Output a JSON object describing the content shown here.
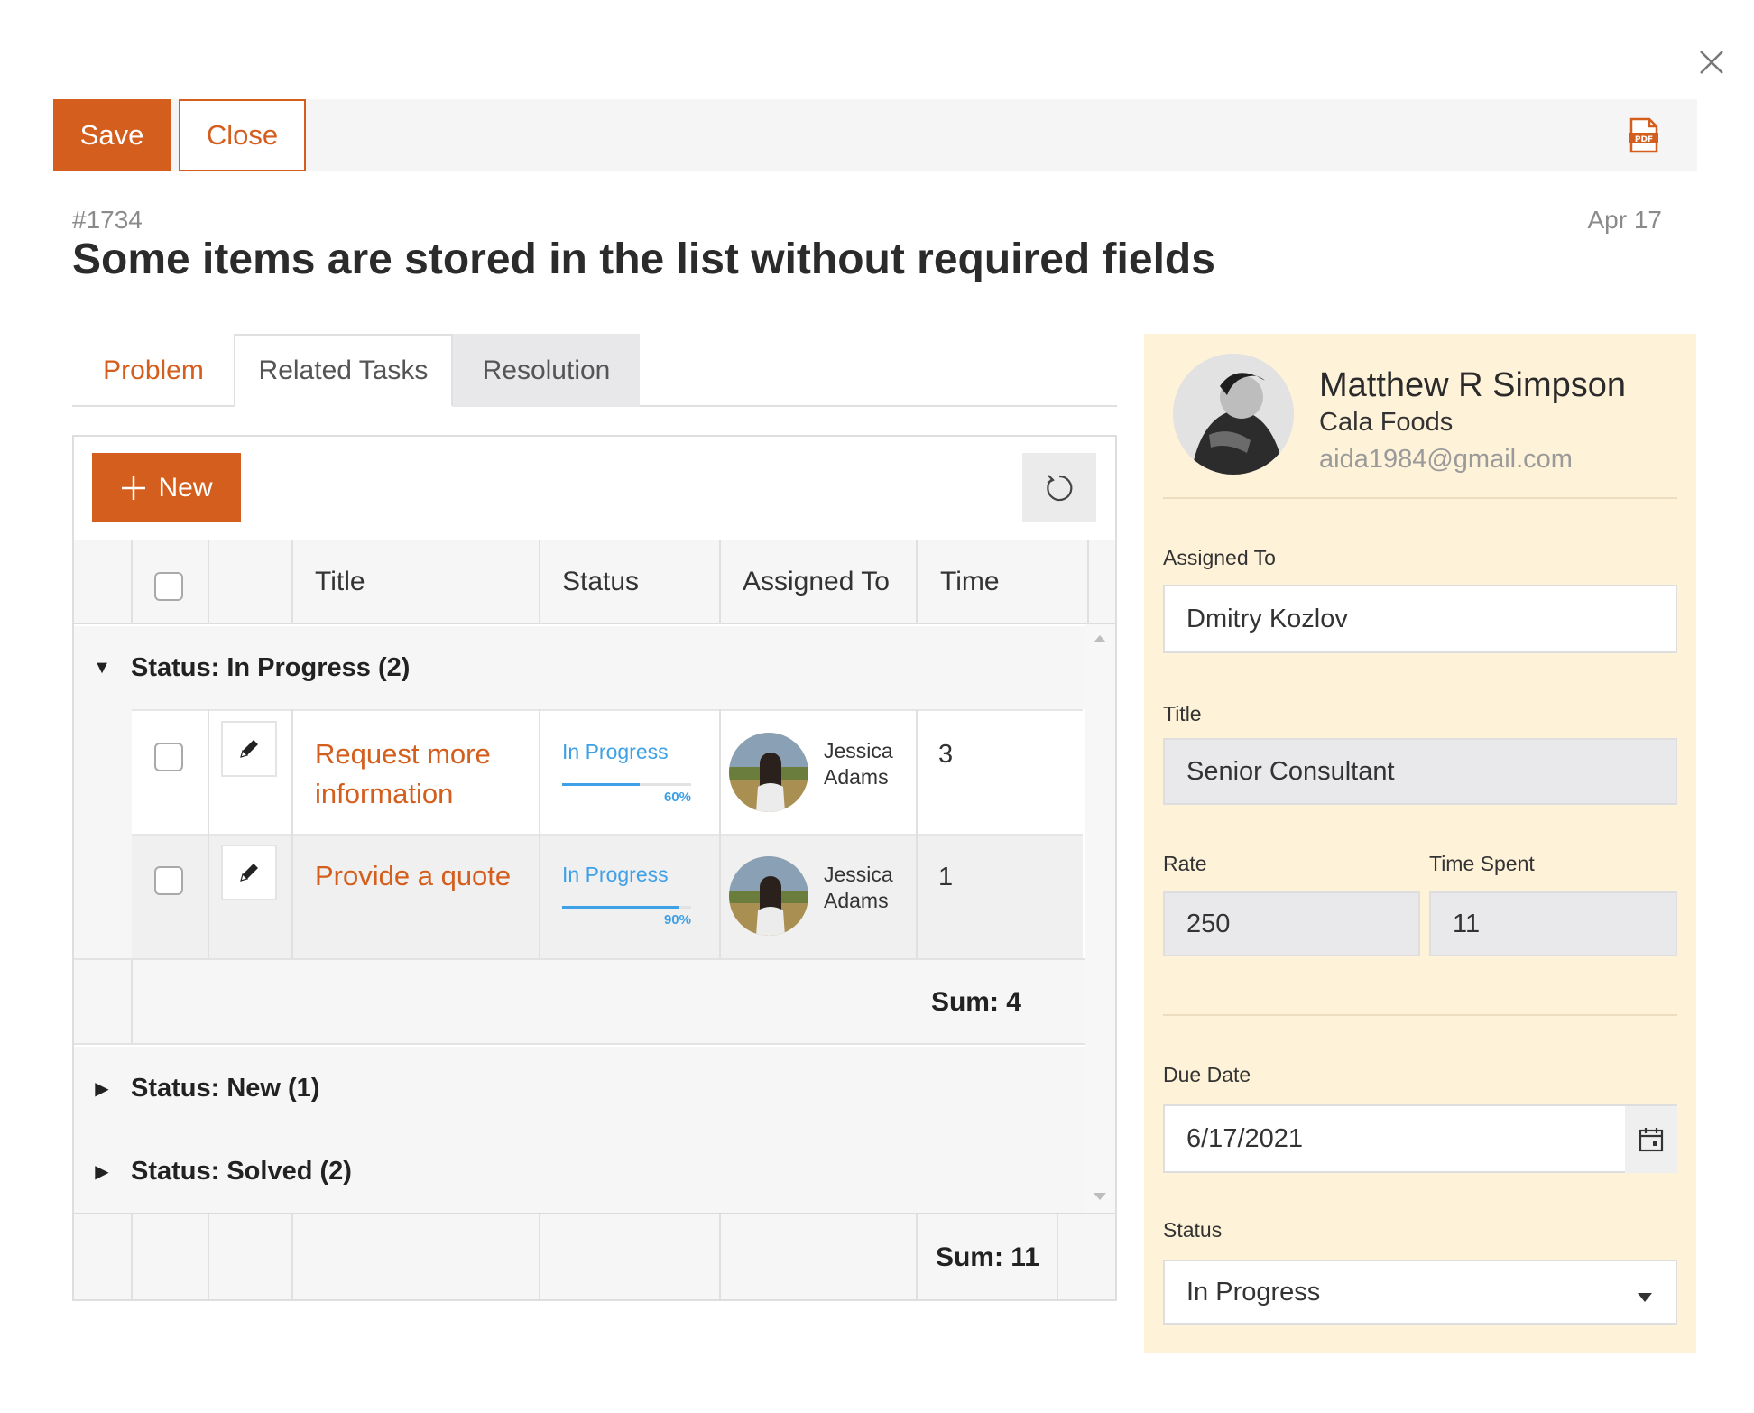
{
  "toolbar": {
    "save_label": "Save",
    "close_label": "Close",
    "pdf_icon": "pdf-file-icon"
  },
  "ticket": {
    "id": "#1734",
    "date": "Apr 17",
    "title": "Some items are stored in the list without required fields"
  },
  "tabs": [
    {
      "label": "Problem",
      "active": false
    },
    {
      "label": "Related Tasks",
      "active": true
    },
    {
      "label": "Resolution",
      "active": false
    }
  ],
  "grid": {
    "new_button_label": "New",
    "columns": [
      "Title",
      "Status",
      "Assigned To",
      "Time"
    ],
    "groups": [
      {
        "label": "Status: In Progress (2)",
        "expanded": true,
        "rows": [
          {
            "title_line1": "Request more",
            "title_line2": "information",
            "status": "In Progress",
            "progress": 60,
            "progress_label": "60%",
            "assignee_first": "Jessica",
            "assignee_last": "Adams",
            "time": "3"
          },
          {
            "title_line1": "Provide a quote",
            "title_line2": "",
            "status": "In Progress",
            "progress": 90,
            "progress_label": "90%",
            "assignee_first": "Jessica",
            "assignee_last": "Adams",
            "time": "1"
          }
        ],
        "sum": "Sum: 4"
      },
      {
        "label": "Status: New (1)",
        "expanded": false
      },
      {
        "label": "Status: Solved (2)",
        "expanded": false
      }
    ],
    "total_sum": "Sum: 11"
  },
  "profile": {
    "name": "Matthew R Simpson",
    "company": "Cala Foods",
    "email": "aida1984@gmail.com"
  },
  "form": {
    "assigned_to_label": "Assigned To",
    "assigned_to_value": "Dmitry Kozlov",
    "title_label": "Title",
    "title_value": "Senior Consultant",
    "rate_label": "Rate",
    "rate_value": "250",
    "time_spent_label": "Time Spent",
    "time_spent_value": "11",
    "due_date_label": "Due Date",
    "due_date_value": "6/17/2021",
    "status_label": "Status",
    "status_value": "In Progress"
  },
  "colors": {
    "accent": "#d35e1d",
    "progress": "#3ea0e6",
    "panel_bg": "#fef2d9"
  }
}
